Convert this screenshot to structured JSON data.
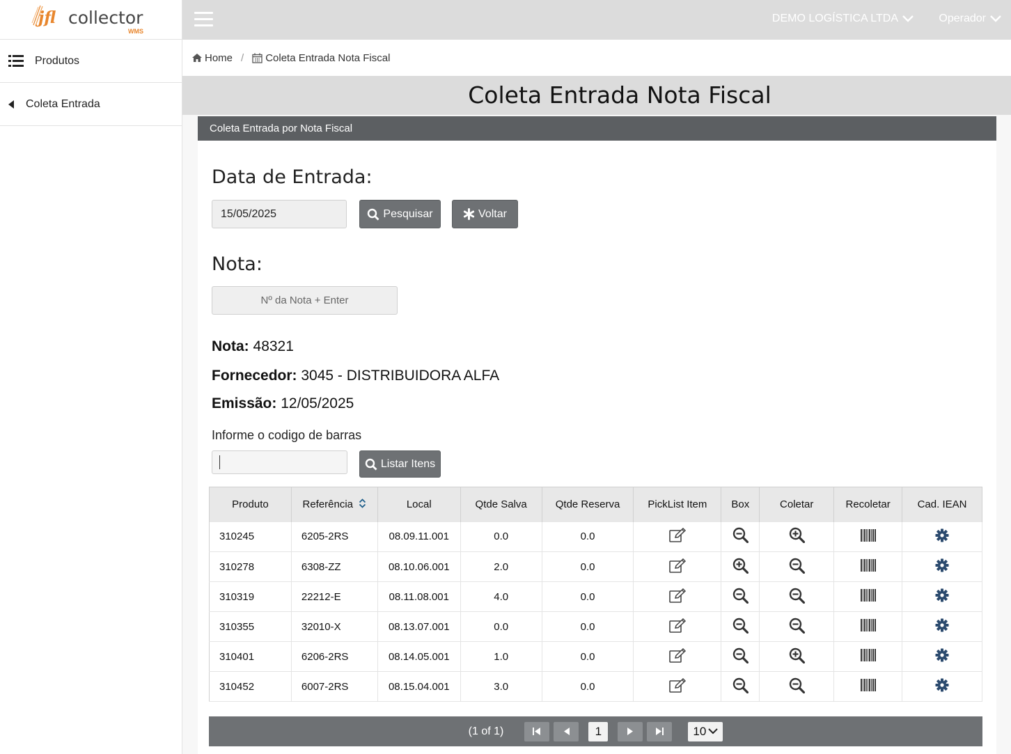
{
  "brand": {
    "name_prefix": "jfl",
    "name_suffix": "collector",
    "tag": "WMS",
    "accent": "#e8862d"
  },
  "sidebar": {
    "items": [
      {
        "label": "Produtos",
        "icon": "list-icon"
      },
      {
        "label": "Coleta Entrada",
        "icon": "caret-left-icon"
      }
    ]
  },
  "topbar": {
    "company": "DEMO LOGÍSTICA LTDA",
    "user": "Operador"
  },
  "breadcrumb": {
    "home": "Home",
    "current": "Coleta Entrada Nota Fiscal",
    "separator": "/"
  },
  "page": {
    "title": "Coleta Entrada Nota Fiscal"
  },
  "panel": {
    "header": "Coleta Entrada por Nota Fiscal",
    "date_label": "Data de Entrada:",
    "date_value": "15/05/2025",
    "search_button": "Pesquisar",
    "back_button": "Voltar",
    "nota_label": "Nota:",
    "nota_placeholder": "Nº da Nota + Enter"
  },
  "info": {
    "nota_key": "Nota:",
    "nota_value": "48321",
    "fornecedor_key": "Fornecedor:",
    "fornecedor_value": "3045 - DISTRIBUIDORA ALFA",
    "emissao_key": "Emissão:",
    "emissao_value": "12/05/2025"
  },
  "barcode": {
    "label": "Informe o codigo de barras",
    "value": "",
    "list_button": "Listar Itens"
  },
  "table": {
    "columns": [
      "Produto",
      "Referência",
      "Local",
      "Qtde Salva",
      "Qtde Reserva",
      "PickList Item",
      "Box",
      "Coletar",
      "Recoletar",
      "Cad. IEAN"
    ],
    "rows": [
      {
        "produto": "310245",
        "referencia": "6205-2RS",
        "local": "08.09.11.001",
        "qtde_salva": "0.0",
        "qtde_reserva": "0.0",
        "box_icon": "zoom-out",
        "coletar_icon": "zoom-in"
      },
      {
        "produto": "310278",
        "referencia": "6308-ZZ",
        "local": "08.10.06.001",
        "qtde_salva": "2.0",
        "qtde_reserva": "0.0",
        "box_icon": "zoom-in",
        "coletar_icon": "zoom-out"
      },
      {
        "produto": "310319",
        "referencia": "22212-E",
        "local": "08.11.08.001",
        "qtde_salva": "4.0",
        "qtde_reserva": "0.0",
        "box_icon": "zoom-out",
        "coletar_icon": "zoom-out"
      },
      {
        "produto": "310355",
        "referencia": "32010-X",
        "local": "08.13.07.001",
        "qtde_salva": "0.0",
        "qtde_reserva": "0.0",
        "box_icon": "zoom-out",
        "coletar_icon": "zoom-out"
      },
      {
        "produto": "310401",
        "referencia": "6206-2RS",
        "local": "08.14.05.001",
        "qtde_salva": "1.0",
        "qtde_reserva": "0.0",
        "box_icon": "zoom-out",
        "coletar_icon": "zoom-in"
      },
      {
        "produto": "310452",
        "referencia": "6007-2RS",
        "local": "08.15.04.001",
        "qtde_salva": "3.0",
        "qtde_reserva": "0.0",
        "box_icon": "zoom-out",
        "coletar_icon": "zoom-out"
      }
    ]
  },
  "paginator": {
    "status": "(1 of 1)",
    "current_page": "1",
    "rows_per_page": "10"
  },
  "colors": {
    "header_gray": "#5c5f62",
    "button_gray": "#6e7174",
    "gear_blue": "#2b4a6e",
    "topbar": "#dcdcdc"
  }
}
